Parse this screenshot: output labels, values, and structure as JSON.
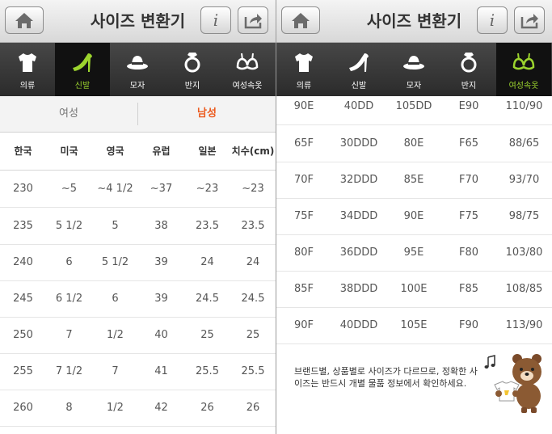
{
  "header": {
    "title": "사이즈 변환기",
    "info_label": "i"
  },
  "tabs": [
    {
      "label": "의류",
      "icon": "shirt-icon"
    },
    {
      "label": "신발",
      "icon": "high-heel-icon"
    },
    {
      "label": "모자",
      "icon": "hat-icon"
    },
    {
      "label": "반지",
      "icon": "ring-icon"
    },
    {
      "label": "여성속옷",
      "icon": "bra-icon"
    }
  ],
  "left": {
    "active_tab": 1,
    "gender_tabs": {
      "female": "여성",
      "male": "남성",
      "selected": "male"
    },
    "columns": [
      "한국",
      "미국",
      "영국",
      "유럽",
      "일본",
      "치수(cm)"
    ],
    "rows": [
      [
        "230",
        "~5",
        "~4 1/2",
        "~37",
        "~23",
        "~23"
      ],
      [
        "235",
        "5 1/2",
        "5",
        "38",
        "23.5",
        "23.5"
      ],
      [
        "240",
        "6",
        "5 1/2",
        "39",
        "24",
        "24"
      ],
      [
        "245",
        "6 1/2",
        "6",
        "39",
        "24.5",
        "24.5"
      ],
      [
        "250",
        "7",
        "1/2",
        "40",
        "25",
        "25"
      ],
      [
        "255",
        "7 1/2",
        "7",
        "41",
        "25.5",
        "25.5"
      ],
      [
        "260",
        "8",
        "1/2",
        "42",
        "26",
        "26"
      ]
    ]
  },
  "right": {
    "active_tab": 4,
    "rows": [
      [
        "90E",
        "40DD",
        "105DD",
        "E90",
        "110/90"
      ],
      [
        "65F",
        "30DDD",
        "80E",
        "F65",
        "88/65"
      ],
      [
        "70F",
        "32DDD",
        "85E",
        "F70",
        "93/70"
      ],
      [
        "75F",
        "34DDD",
        "90E",
        "F75",
        "98/75"
      ],
      [
        "80F",
        "36DDD",
        "95E",
        "F80",
        "103/80"
      ],
      [
        "85F",
        "38DDD",
        "100E",
        "F85",
        "108/85"
      ],
      [
        "90F",
        "40DDD",
        "105E",
        "F90",
        "113/90"
      ]
    ],
    "notice": "브랜드별, 상품별로 사이즈가 다르므로, 정확한 사이즈는 반드시 개별 물품 정보에서 확인하세요."
  },
  "colors": {
    "active_tab_text": "#9cd42e",
    "selected_gender": "#ec5b1f",
    "tab_bar": "#333333",
    "header": "#e2e2e2"
  }
}
